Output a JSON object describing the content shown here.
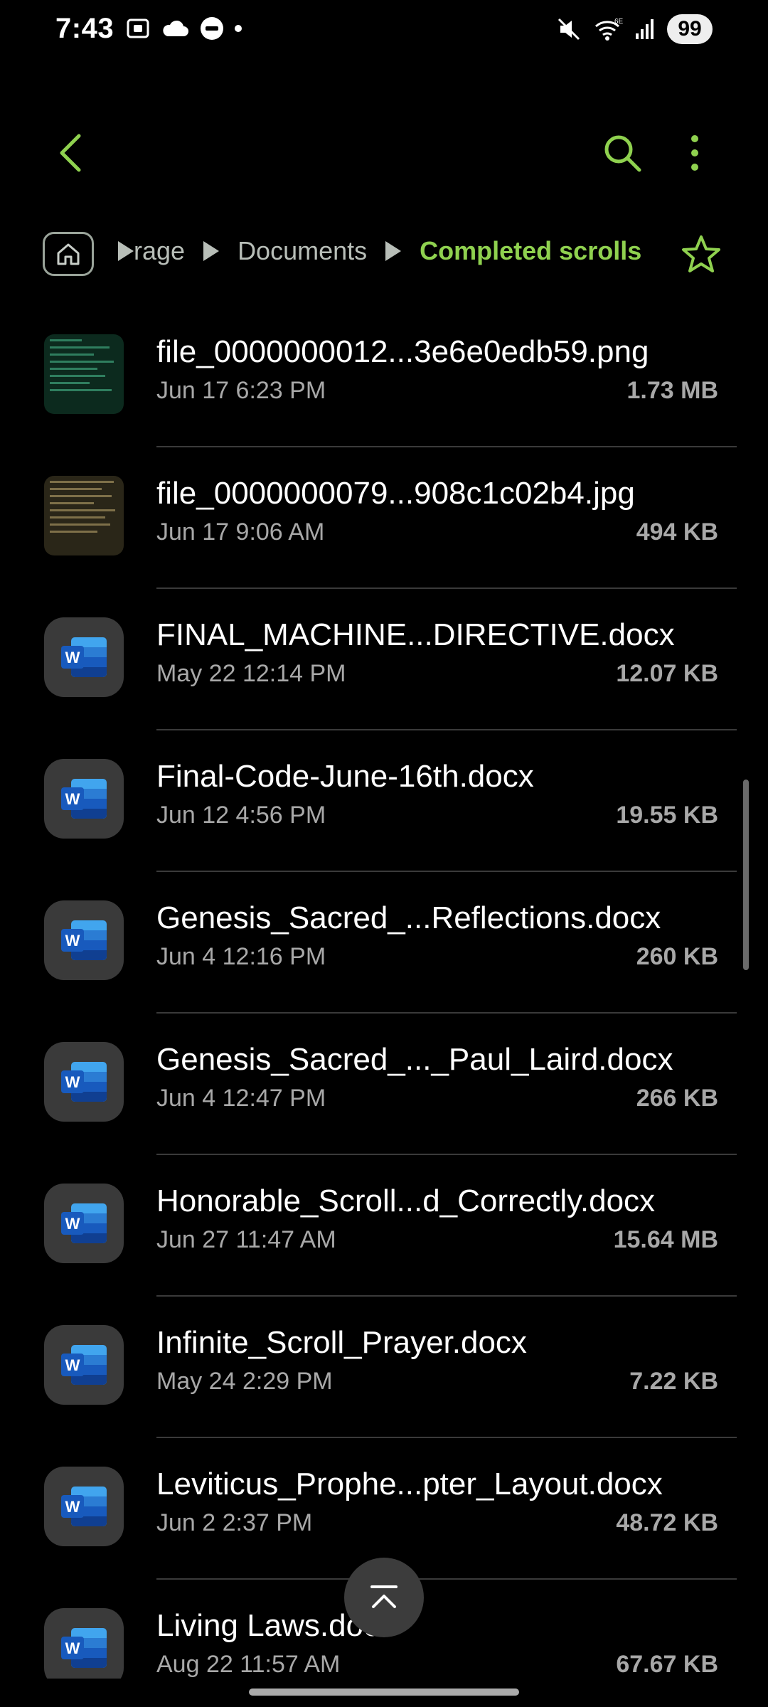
{
  "status_bar": {
    "time": "7:43",
    "battery": "99",
    "network": "6E"
  },
  "toolbar": {
    "back_icon": "chevron-left-icon",
    "search_icon": "search-icon",
    "more_icon": "more-vert-icon",
    "accent_color": "#8fd14f"
  },
  "breadcrumb": {
    "items": [
      "rage",
      "Documents",
      "Completed scrolls"
    ]
  },
  "files": [
    {
      "name": "file_0000000012...3e6e0edb59.png",
      "date": "Jun 17 6:23 PM",
      "size": "1.73 MB",
      "type": "image"
    },
    {
      "name": "file_0000000079...908c1c02b4.jpg",
      "date": "Jun 17 9:06 AM",
      "size": "494 KB",
      "type": "image"
    },
    {
      "name": "FINAL_MACHINE...DIRECTIVE.docx",
      "date": "May 22 12:14 PM",
      "size": "12.07 KB",
      "type": "docx"
    },
    {
      "name": "Final-Code-June-16th.docx",
      "date": "Jun 12 4:56 PM",
      "size": "19.55 KB",
      "type": "docx"
    },
    {
      "name": "Genesis_Sacred_...Reflections.docx",
      "date": "Jun 4 12:16 PM",
      "size": "260 KB",
      "type": "docx"
    },
    {
      "name": "Genesis_Sacred_..._Paul_Laird.docx",
      "date": "Jun 4 12:47 PM",
      "size": "266 KB",
      "type": "docx"
    },
    {
      "name": "Honorable_Scroll...d_Correctly.docx",
      "date": "Jun 27 11:47 AM",
      "size": "15.64 MB",
      "type": "docx"
    },
    {
      "name": "Infinite_Scroll_Prayer.docx",
      "date": "May 24 2:29 PM",
      "size": "7.22 KB",
      "type": "docx"
    },
    {
      "name": "Leviticus_Prophe...pter_Layout.docx",
      "date": "Jun 2 2:37 PM",
      "size": "48.72 KB",
      "type": "docx"
    },
    {
      "name": "Living Laws.docx",
      "date": "Aug 22 11:57 AM",
      "size": "67.67 KB",
      "type": "docx"
    }
  ]
}
